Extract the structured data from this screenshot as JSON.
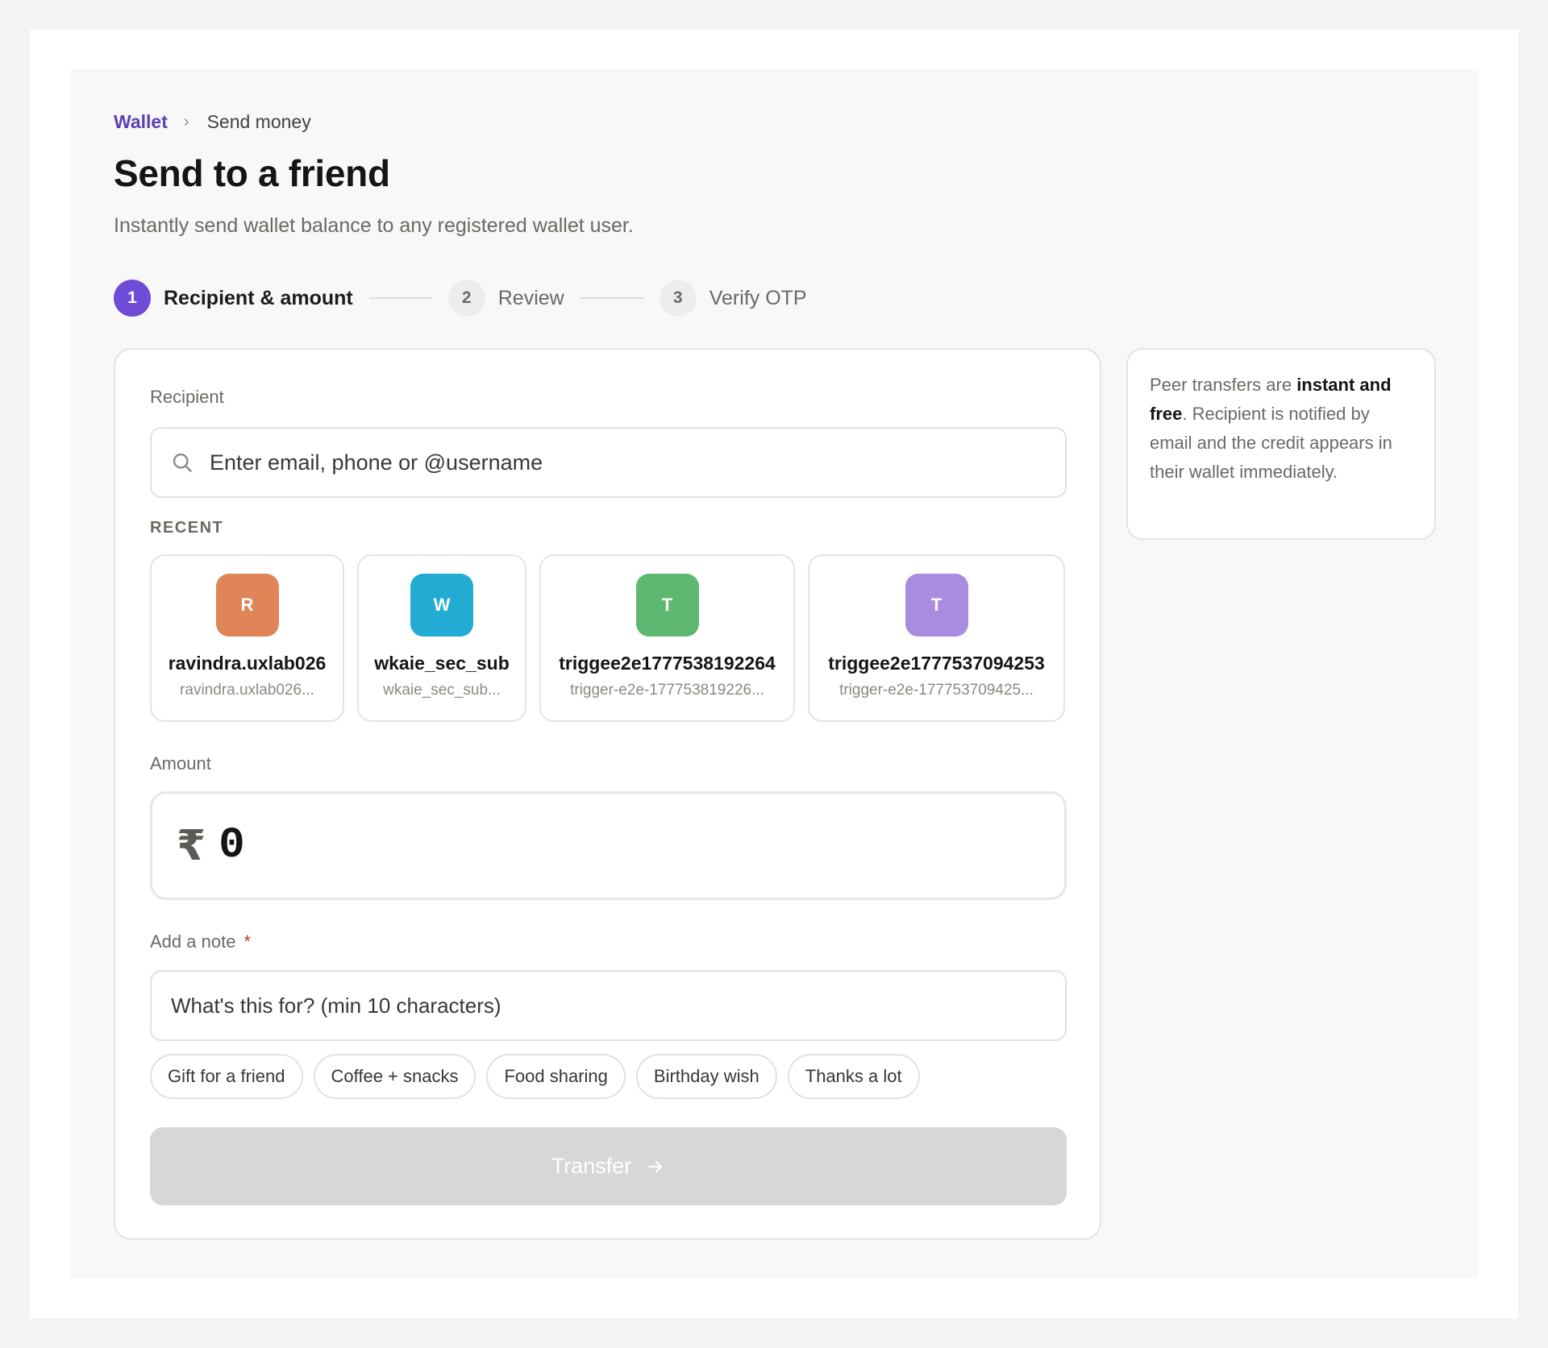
{
  "breadcrumb": {
    "root": "Wallet",
    "separator": "›",
    "current": "Send money"
  },
  "page": {
    "title": "Send to a friend",
    "subtitle": "Instantly send wallet balance to any registered wallet user."
  },
  "steps": [
    {
      "num": "1",
      "label": "Recipient & amount",
      "active": true
    },
    {
      "num": "2",
      "label": "Review",
      "active": false
    },
    {
      "num": "3",
      "label": "Verify OTP",
      "active": false
    }
  ],
  "recipient": {
    "label": "Recipient",
    "placeholder": "Enter email, phone or @username",
    "icon": "search-icon"
  },
  "recent": {
    "label": "RECENT",
    "items": [
      {
        "initial": "R",
        "name": "ravindra.uxlab026",
        "sub": "ravindra.uxlab026...",
        "color": "#e08558"
      },
      {
        "initial": "W",
        "name": "wkaie_sec_sub",
        "sub": "wkaie_sec_sub...",
        "color": "#22acd4"
      },
      {
        "initial": "T",
        "name": "triggee2e1777538192264",
        "sub": "trigger-e2e-177753819226...",
        "color": "#5fb871"
      },
      {
        "initial": "T",
        "name": "triggee2e1777537094253",
        "sub": "trigger-e2e-177753709425...",
        "color": "#a98be0"
      }
    ]
  },
  "amount": {
    "label": "Amount",
    "currency": "₹",
    "value": "0"
  },
  "note": {
    "label": "Add a note",
    "required_mark": "*",
    "placeholder": "What's this for? (min 10 characters)",
    "chips": [
      "Gift for a friend",
      "Coffee + snacks",
      "Food sharing",
      "Birthday wish",
      "Thanks a lot"
    ]
  },
  "transfer": {
    "label": "Transfer",
    "icon": "arrow-right-icon"
  },
  "info": {
    "text_before": "Peer transfers are ",
    "bold": "instant and free",
    "text_after": ". Recipient is notified by email and the credit appears in their wallet immediately."
  },
  "colors": {
    "accent": "#6f4bd8",
    "link": "#5b3fb3",
    "disabled_button": "#d9d7d6"
  }
}
